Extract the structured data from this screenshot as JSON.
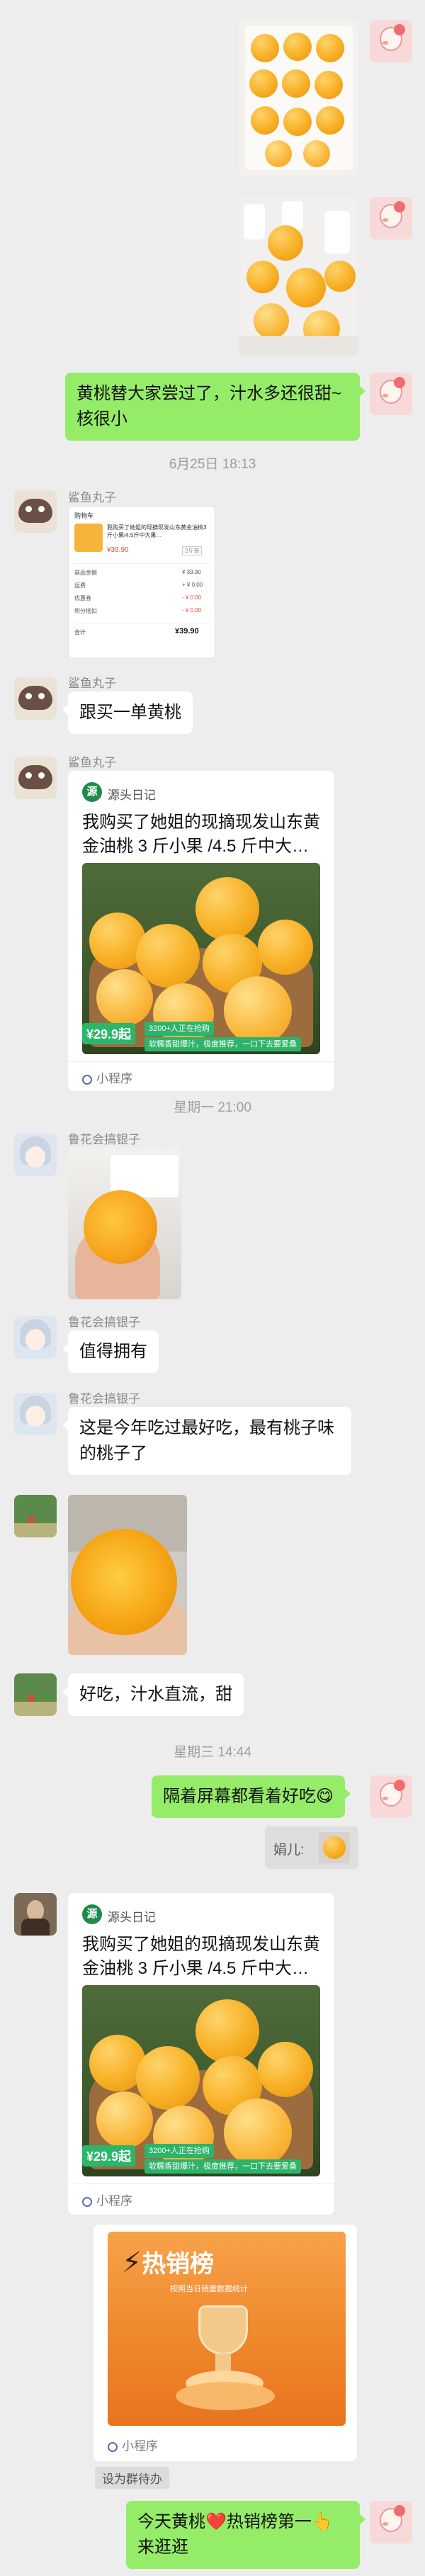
{
  "messages": {
    "m1_text": "黄桃替大家尝过了，汁水多还很甜~核很小",
    "time1": "6月25日 18:13",
    "shark_name": "鲨鱼丸子",
    "shop": {
      "header": "购物车",
      "product": "我购买了她姐的现摘现发山东黄金油桃3斤小果/4.5斤中大果…",
      "price": "¥39",
      "price_suffix": ".90",
      "spec": "2斤装",
      "row1_label": "商品金额",
      "row1_value": "¥ 39.90",
      "row2_label": "运费",
      "row2_value": "+ ¥ 0.00",
      "row3_label": "优惠券",
      "row3_value": "- ¥ 0.00",
      "row4_label": "积分抵扣",
      "row4_value": "- ¥ 0.00",
      "total_label": "合计",
      "total_value": "¥39.90"
    },
    "m3_text": "跟买一单黄桃",
    "card": {
      "source": "源头日记",
      "logo": "源",
      "title": "我购买了她姐的现摘现发山东黄金油桃 3 斤小果 /4.5 斤中大…",
      "price": "¥29.9起",
      "buyers": "3200+人正在抢购",
      "slogan": "软糯香甜爆汁，极度推荐，一口下去要爱桑",
      "footer": "小程序"
    },
    "time2": "星期一 21:00",
    "lu_name": "鲁花会搞银子",
    "m5_text": "值得拥有",
    "m6_text": "这是今年吃过最好吃，最有桃子味的桃子了",
    "m8_text": "好吃，汁水直流，甜",
    "time3": "星期三 14:44",
    "m9_text": "隔着屏幕都看着好吃😋",
    "quote_label": "娟儿:",
    "rank": {
      "title": "热销榜",
      "subtitle": "按照当日销量数据统计",
      "footer": "小程序"
    },
    "set_pending": "设为群待办",
    "m12_text": "今天黄桃❤️热销榜第一👆来逛逛"
  }
}
